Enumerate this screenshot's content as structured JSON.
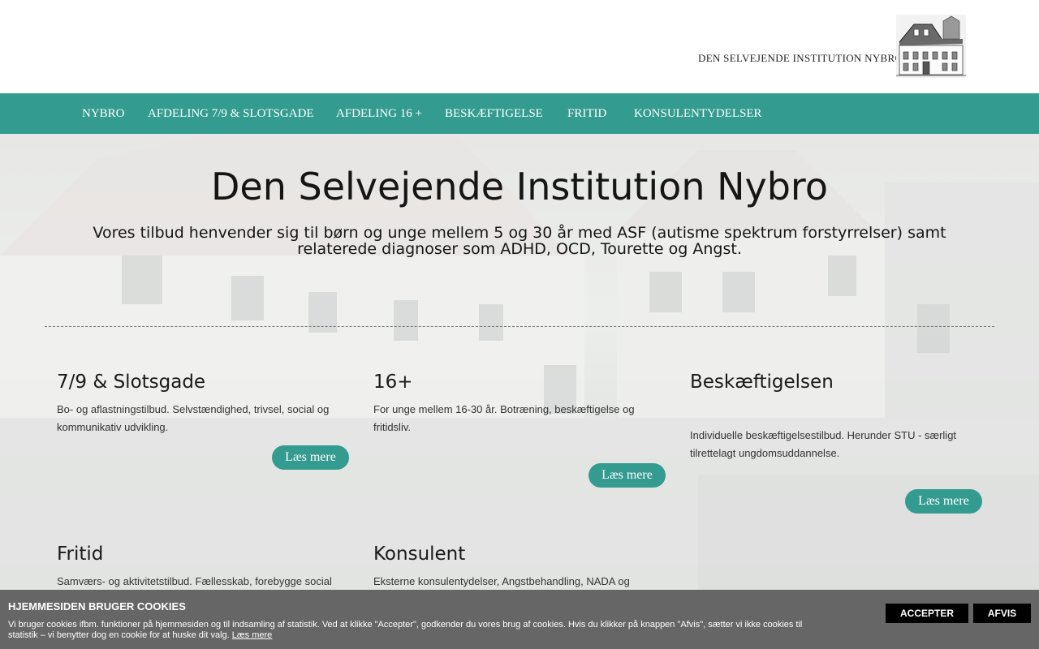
{
  "header": {
    "logo_text": "DEN SELVEJENDE INSTITUTION NYBRO"
  },
  "nav": {
    "items": [
      {
        "label": "NYBRO"
      },
      {
        "label": "AFDELING 7/9 & SLOTSGADE"
      },
      {
        "label": "AFDELING 16 +"
      },
      {
        "label": "BESKÆFTIGELSE"
      },
      {
        "label": "FRITID"
      },
      {
        "label": "KONSULENTYDELSER"
      }
    ]
  },
  "hero": {
    "title": "Den Selvejende Institution Nybro",
    "subtitle": "Vores tilbud henvender sig til børn og unge mellem 5 og 30 år med ASF (autisme spektrum forstyrrelser) samt relaterede diagnoser som ADHD, OCD, Tourette og Angst."
  },
  "cards": [
    {
      "title": "7/9 & Slotsgade",
      "text": "Bo- og aflastningstilbud. Selvstændighed, trivsel, social og kommunikativ udvikling.",
      "button": "Læs mere"
    },
    {
      "title": "16+",
      "text": "For unge mellem 16-30 år. Botræning, beskæftigelse og fritidsliv.",
      "button": "Læs mere"
    },
    {
      "title": "Beskæftigelsen",
      "text": "Individuelle beskæftigelsestilbud. Herunder STU - særligt tilrettelagt ungdomsuddannelse.",
      "button": "Læs mere"
    },
    {
      "title": "Fritid",
      "text": "Samværs- og aktivitetstilbud. Fællesskab, forebygge social"
    },
    {
      "title": "Konsulent",
      "text": "Eksterne konsulentydelser, Angstbehandling, NADA og"
    }
  ],
  "cookie": {
    "title": "HJEMMESIDEN BRUGER COOKIES",
    "text": "Vi bruger cookies ifbm. funktioner på hjemmesiden og til indsamling af statistik. Ved at klikke \"Accepter\", godkender du vores brug af cookies. Hvis du klikker på knappen \"Afvis\", sætter vi ikke cookies til statistik – vi benytter dog en cookie for at huske dit valg.",
    "link": "Læs mere",
    "accept": "ACCEPTER",
    "reject": "AFVIS"
  },
  "colors": {
    "accent": "#339b90",
    "cookie_bar": "#666666"
  }
}
